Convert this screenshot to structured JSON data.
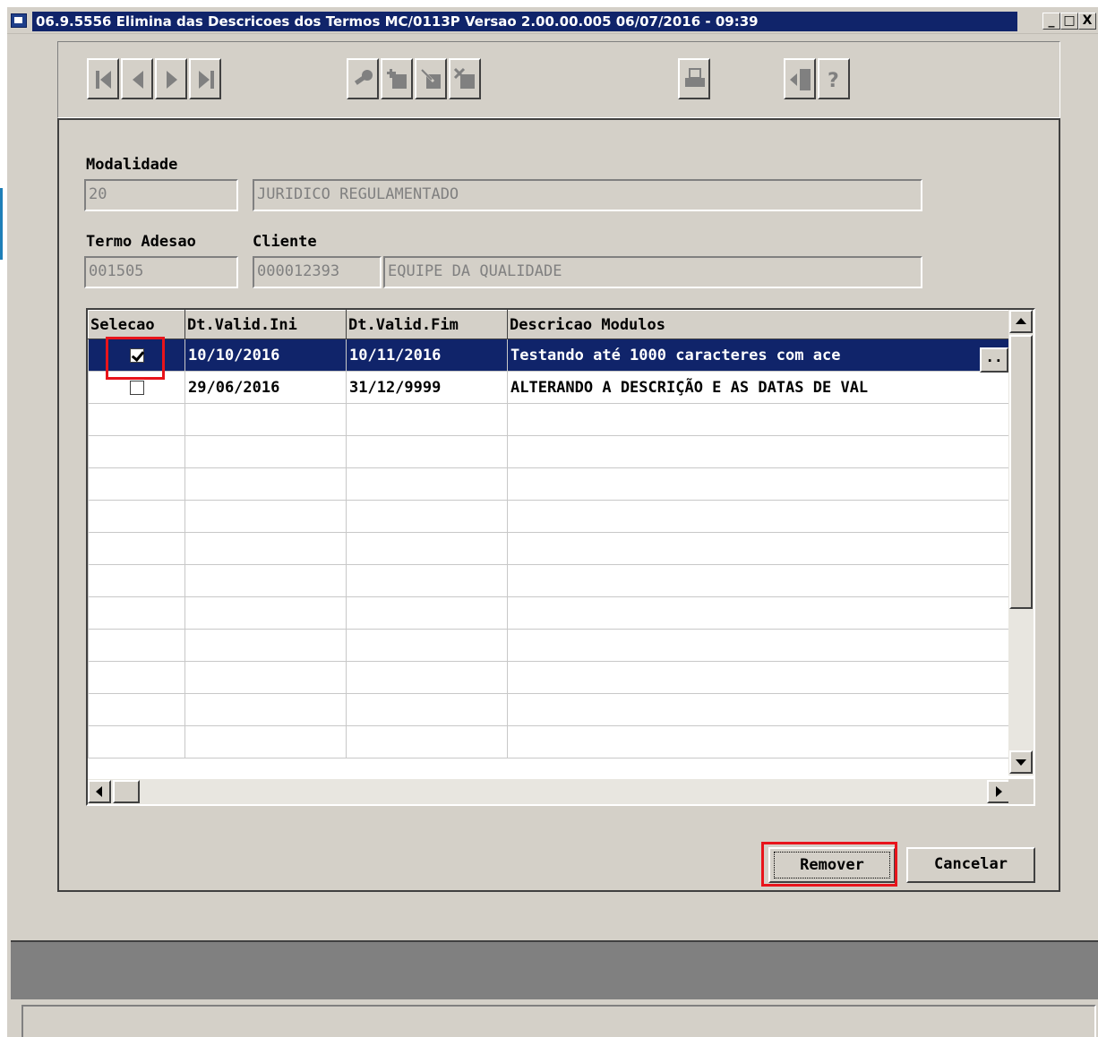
{
  "window": {
    "title": "06.9.5556  Elimina das Descricoes dos Termos MC/0113P Versao 2.00.00.005 06/07/2016 - 09:39",
    "controls": [
      "_",
      "□",
      "X"
    ]
  },
  "toolbar": {
    "buttons": [
      {
        "name": "first-record",
        "icon": "first-icon"
      },
      {
        "name": "previous-record",
        "icon": "previous-icon"
      },
      {
        "name": "next-record",
        "icon": "next-icon"
      },
      {
        "name": "last-record",
        "icon": "last-icon"
      },
      {
        "name": "search",
        "icon": "key-icon"
      },
      {
        "name": "add",
        "icon": "add-icon"
      },
      {
        "name": "edit",
        "icon": "edit-icon"
      },
      {
        "name": "delete",
        "icon": "delete-icon"
      },
      {
        "name": "print",
        "icon": "printer-icon"
      },
      {
        "name": "exit",
        "icon": "exit-icon"
      },
      {
        "name": "help",
        "icon": "help-icon"
      }
    ]
  },
  "form": {
    "modalidade_label": "Modalidade",
    "modalidade_code": "20",
    "modalidade_desc": "JURIDICO REGULAMENTADO",
    "termo_label": "Termo Adesao",
    "cliente_label": "Cliente",
    "termo_value": "001505",
    "cliente_code": "000012393",
    "cliente_name": "EQUIPE DA QUALIDADE"
  },
  "grid": {
    "columns": [
      "Selecao",
      "Dt.Valid.Ini",
      "Dt.Valid.Fim",
      "Descricao Modulos"
    ],
    "rows": [
      {
        "selected": true,
        "ini": "10/10/2016",
        "fim": "10/11/2016",
        "desc": "Testando até 1000 caracteres com ace"
      },
      {
        "selected": false,
        "ini": "29/06/2016",
        "fim": "31/12/9999",
        "desc": "ALTERANDO A DESCRIÇÃO E AS DATAS DE VAL"
      }
    ],
    "ellipsis_label": ".."
  },
  "actions": {
    "remove_label": "Remover",
    "cancel_label": "Cancelar"
  },
  "colors": {
    "selection": "#10246a",
    "highlight": "#e8141b",
    "face": "#d4d0c8"
  }
}
